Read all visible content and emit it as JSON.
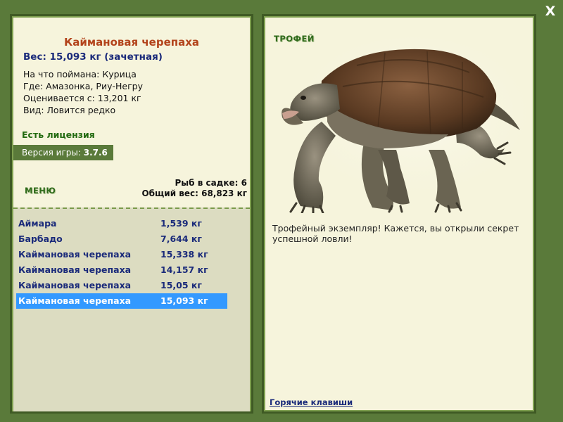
{
  "close_label": "X",
  "fish": {
    "name": "Каймановая черепаха",
    "weight_line": "Вес: 15,093 кг (зачетная)",
    "bait": "На что поймана: Курица",
    "location": "Где: Амазонка, Риу-Негру",
    "valued_from": "Оценивается с: 13,201 кг",
    "rarity": "Вид: Ловится редко"
  },
  "license": "Есть лицензия",
  "version": {
    "label": "Версия игры: ",
    "value": "3.7.6"
  },
  "menu_label": "МЕНЮ",
  "keepnet": {
    "count": "Рыб в садке: 6",
    "total": "Общий вес: 68,823 кг"
  },
  "catches": [
    {
      "name": "Аймара",
      "weight": "1,539 кг"
    },
    {
      "name": "Барбадо",
      "weight": "7,644 кг"
    },
    {
      "name": "Каймановая черепаха",
      "weight": "15,338 кг"
    },
    {
      "name": "Каймановая черепаха",
      "weight": "14,157 кг"
    },
    {
      "name": "Каймановая черепаха",
      "weight": "15,05 кг"
    },
    {
      "name": "Каймановая черепаха",
      "weight": "15,093 кг"
    }
  ],
  "selected_catch_index": 5,
  "trophy": {
    "label": "ТРОФЕЙ",
    "text": "Трофейный экземпляр! Кажется, вы открыли секрет успешной ловли!",
    "image": "snapping-turtle"
  },
  "hotkeys_label": "Горячие клавиши",
  "colors": {
    "frame": "#5a7a3a",
    "panel": "#f6f4dc",
    "title": "#b3441c",
    "text_blue": "#1a2a7a",
    "green_label": "#2e6a1a",
    "selection": "#3399ff"
  }
}
